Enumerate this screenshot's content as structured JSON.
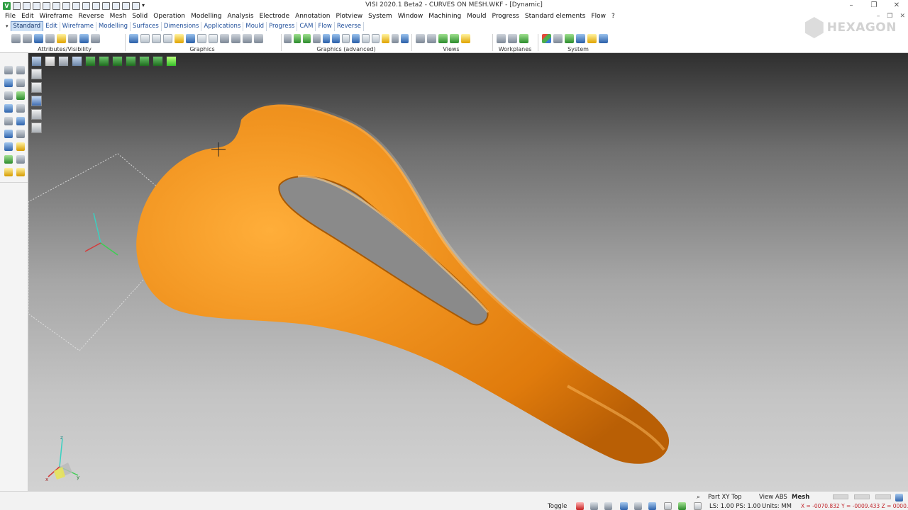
{
  "window": {
    "title": "VISI 2020.1 Beta2 - CURVES ON MESH.WKF - [Dynamic]",
    "controls": [
      "–",
      "❐",
      "✕"
    ],
    "doc_controls": [
      "–",
      "❐",
      "✕"
    ],
    "app_logo_letter": "V"
  },
  "menu": {
    "items": [
      "File",
      "Edit",
      "Wireframe",
      "Reverse",
      "Mesh",
      "Solid",
      "Operation",
      "Modelling",
      "Analysis",
      "Electrode",
      "Annotation",
      "Plotview",
      "System",
      "Window",
      "Machining",
      "Mould",
      "Progress",
      "Standard elements",
      "Flow",
      "?"
    ]
  },
  "tabs": {
    "items": [
      "Standard",
      "Edit",
      "Wireframe",
      "Modelling",
      "Surfaces",
      "Dimensions",
      "Applications",
      "Mould",
      "Progress",
      "CAM",
      "Flow",
      "Reverse"
    ],
    "active": "Standard"
  },
  "ribbon": {
    "groups": [
      {
        "label": "Attributes/Visibility",
        "icons": [
          "layers-icon",
          "printer-icon",
          "attribute-icon",
          "visibility-icon",
          "hide-icon",
          "colour-icon",
          "show-icon",
          "filter-icon"
        ]
      },
      {
        "label": "Graphics",
        "icons": [
          "regenerate-icon",
          "wireframe-view-icon",
          "shaded-view-icon",
          "hidden-line-icon",
          "solid-view-icon",
          "transparent-view-icon",
          "render-view-icon",
          "edges-view-icon",
          "smooth-view-icon",
          "clip-icon",
          "mesh-view-icon",
          "grid-icon"
        ]
      },
      {
        "label": "Graphics (advanced)",
        "icons": [
          "lighting-icon",
          "material-icon",
          "texture-icon",
          "shadow-icon",
          "section-icon",
          "silhouette-icon",
          "reflection-icon",
          "environment-icon",
          "exposure-icon",
          "backface-icon",
          "curvature-icon",
          "quality-icon",
          "shield-icon"
        ]
      },
      {
        "label": "Views",
        "icons": [
          "zoom-window-icon",
          "zoom-all-icon",
          "pan-icon",
          "rotate-icon",
          "view-cube-icon"
        ]
      },
      {
        "label": "Workplanes",
        "icons": [
          "workplane-icon",
          "workplane-origin-icon",
          "workplane-align-icon"
        ]
      },
      {
        "label": "System",
        "icons": [
          "palette-icon",
          "calculator-icon",
          "globe-icon",
          "system-view-icon",
          "settings-icon",
          "license-icon"
        ]
      }
    ],
    "brand": "HEXAGON"
  },
  "statusbar": {
    "part_view": "Part XY Top",
    "view_abs": "View ABS",
    "mesh": "Mesh",
    "toggle": "Toggle",
    "layer_pen": "LS: 1.00 PS: 1.00",
    "units": "Units: MM",
    "coords": "X = -0070.832 Y = -0009.433 Z = 0000.000"
  },
  "colors": {
    "model": "#e98314",
    "accent": "#1f4e9a",
    "status_coords": "#c0262c"
  }
}
